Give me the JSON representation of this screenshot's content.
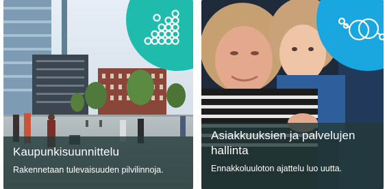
{
  "cards": [
    {
      "title": "Kaupunkisuunnittelu",
      "subtitle": "Rakennetaan tulevaisuuden pilvilinnoja.",
      "icon": "ascending-dots-icon",
      "badge_color": "#1fbcae"
    },
    {
      "title": "Asiakkuuksien ja palvelujen hallinta",
      "subtitle": "Ennakkoluuloton ajattelu luo uutta.",
      "icon": "overlapping-circles-icon",
      "badge_color": "#1aa6df"
    }
  ]
}
